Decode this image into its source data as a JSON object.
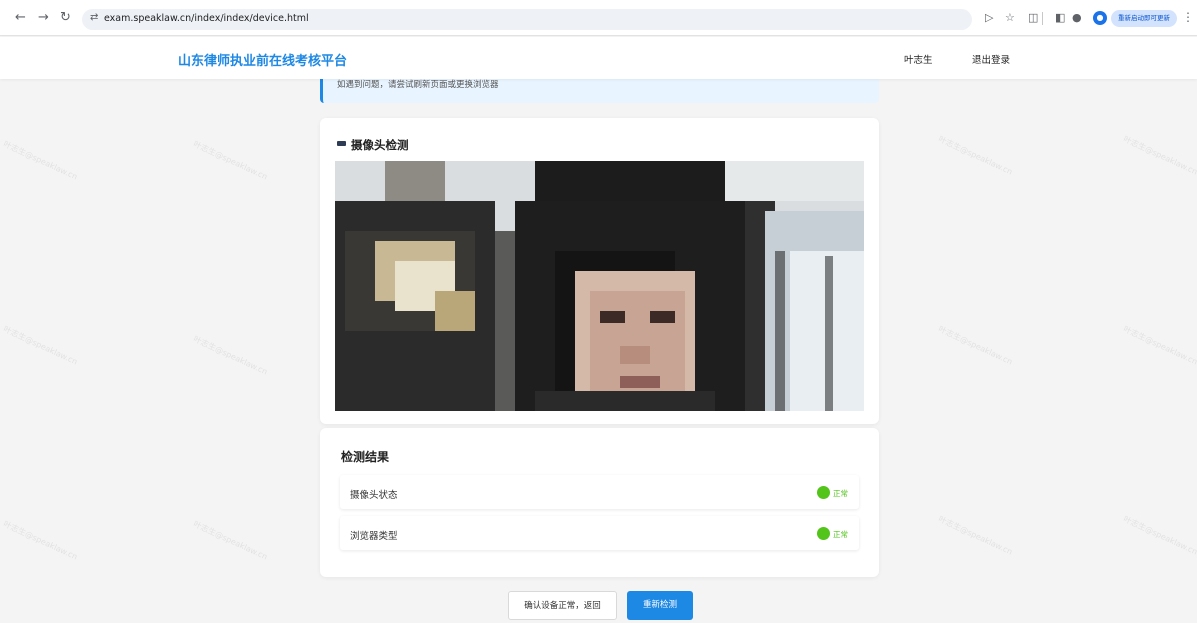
{
  "browser": {
    "url": "exam.speaklaw.cn/index/index/device.html",
    "update_label": "重新启动即可更新"
  },
  "header": {
    "site_title": "山东律师执业前在线考核平台",
    "user_name": "叶志生",
    "logout_label": "退出登录"
  },
  "notice": {
    "text": "如遇到问题，请尝试刷新页面或更换浏览器"
  },
  "camera_section": {
    "title": "摄像头检测"
  },
  "results": {
    "title": "检测结果",
    "items": [
      {
        "label": "摄像头状态",
        "status": "正常"
      },
      {
        "label": "浏览器类型",
        "status": "正常"
      }
    ]
  },
  "buttons": {
    "confirm_label": "确认设备正常，返回",
    "retest_label": "重新检测"
  },
  "watermark": {
    "text": "叶志生@speaklaw.cn"
  },
  "colors": {
    "accent": "#1e88e5",
    "success": "#52c41a",
    "background": "#f4f4f4"
  }
}
